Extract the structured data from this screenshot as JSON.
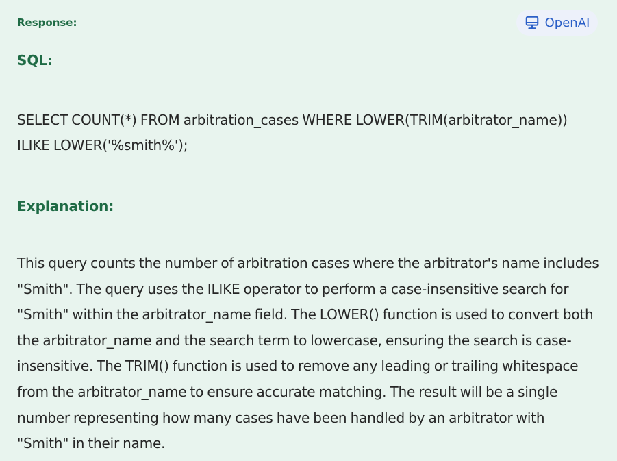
{
  "response": {
    "label": "Response:"
  },
  "provider_badge": {
    "label": "OpenAI",
    "icon": "monitor-icon",
    "color": "#2b5fc7"
  },
  "sections": {
    "sql_heading": "SQL:",
    "sql_query": "SELECT COUNT(*) FROM arbitration_cases WHERE LOWER(TRIM(arbitrator_name)) ILIKE LOWER('%smith%');",
    "explanation_heading": "Explanation:",
    "explanation_text": "This query counts the number of arbitration cases where the arbitrator's name includes \"Smith\". The query uses the ILIKE operator to perform a case-insensitive search for \"Smith\" within the arbitrator_name field. The LOWER() function is used to convert both the arbitrator_name and the search term to lowercase, ensuring the search is case-insensitive. The TRIM() function is used to remove any leading or trailing whitespace from the arbitrator_name to ensure accurate matching. The result will be a single number representing how many cases have been handled by an arbitrator with \"Smith\" in their name."
  },
  "colors": {
    "background": "#e8f4ee",
    "heading": "#1f6b45",
    "body_text": "#262626",
    "badge_background": "#edf1fa"
  }
}
